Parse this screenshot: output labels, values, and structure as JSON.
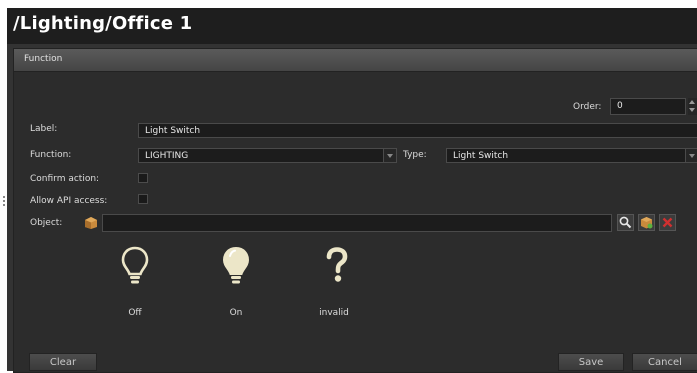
{
  "title": "/Lighting/Office 1",
  "section": {
    "header": "Function"
  },
  "form": {
    "order_label": "Order:",
    "order_value": "0",
    "label_label": "Label:",
    "label_value": "Light Switch",
    "function_label": "Function:",
    "function_value": "LIGHTING",
    "type_label": "Type:",
    "type_value": "Light Switch",
    "confirm_label": "Confirm action:",
    "confirm_checked": false,
    "api_label": "Allow API access:",
    "api_checked": false,
    "object_label": "Object:",
    "object_value": ""
  },
  "object_buttons": [
    "search-icon",
    "package-icon",
    "delete-icon"
  ],
  "states": [
    {
      "label": "Off",
      "icon": "bulb-off-icon"
    },
    {
      "label": "On",
      "icon": "bulb-on-icon"
    },
    {
      "label": "invalid",
      "icon": "question-icon"
    }
  ],
  "buttons": {
    "clear": "Clear",
    "save": "Save",
    "cancel": "Cancel"
  },
  "colors": {
    "background": "#333333",
    "field": "#1c1c1c",
    "text": "#e8e8e8",
    "bulb_on": "#ece6c8"
  }
}
